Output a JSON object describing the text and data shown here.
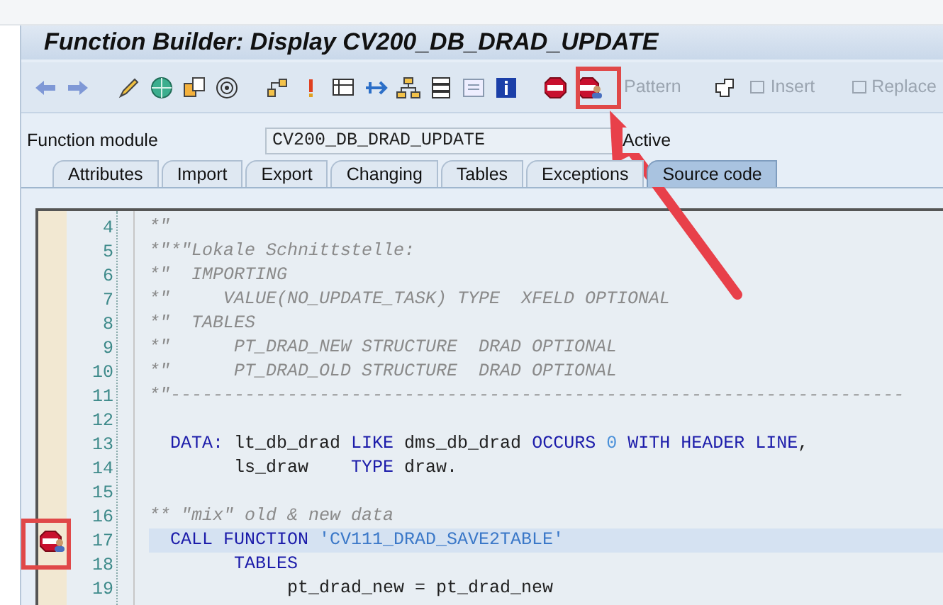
{
  "window": {
    "title": "Function Builder: Display CV200_DB_DRAD_UPDATE"
  },
  "toolbar_buttons": [
    {
      "label": "Pattern",
      "disabled": true
    },
    {
      "label": "Insert",
      "disabled": true
    },
    {
      "label": "Replace",
      "disabled": true
    }
  ],
  "field": {
    "label": "Function module",
    "value": "CV200_DB_DRAD_UPDATE",
    "status": "Active"
  },
  "tabs": [
    {
      "label": "Attributes",
      "selected": false
    },
    {
      "label": "Import",
      "selected": false
    },
    {
      "label": "Export",
      "selected": false
    },
    {
      "label": "Changing",
      "selected": false
    },
    {
      "label": "Tables",
      "selected": false
    },
    {
      "label": "Exceptions",
      "selected": false
    },
    {
      "label": "Source code",
      "selected": true
    }
  ],
  "code_lines": [
    {
      "number": "4",
      "selected": false,
      "breakpoint": false,
      "segments": [
        {
          "kind": "comment",
          "text": "*\""
        }
      ]
    },
    {
      "number": "5",
      "selected": false,
      "breakpoint": false,
      "segments": [
        {
          "kind": "comment",
          "text": "*\"*\"Lokale Schnittstelle:"
        }
      ]
    },
    {
      "number": "6",
      "selected": false,
      "breakpoint": false,
      "segments": [
        {
          "kind": "comment",
          "text": "*\"  IMPORTING"
        }
      ]
    },
    {
      "number": "7",
      "selected": false,
      "breakpoint": false,
      "segments": [
        {
          "kind": "comment",
          "text": "*\"     VALUE(NO_UPDATE_TASK) TYPE  XFELD OPTIONAL"
        }
      ]
    },
    {
      "number": "8",
      "selected": false,
      "breakpoint": false,
      "segments": [
        {
          "kind": "comment",
          "text": "*\"  TABLES"
        }
      ]
    },
    {
      "number": "9",
      "selected": false,
      "breakpoint": false,
      "segments": [
        {
          "kind": "comment",
          "text": "*\"      PT_DRAD_NEW STRUCTURE  DRAD OPTIONAL"
        }
      ]
    },
    {
      "number": "10",
      "selected": false,
      "breakpoint": false,
      "segments": [
        {
          "kind": "comment",
          "text": "*\"      PT_DRAD_OLD STRUCTURE  DRAD OPTIONAL"
        }
      ]
    },
    {
      "number": "11",
      "selected": false,
      "breakpoint": false,
      "segments": [
        {
          "kind": "comment",
          "text": "*\"---------------------------------------------------------------------"
        }
      ]
    },
    {
      "number": "12",
      "selected": false,
      "breakpoint": false
    },
    {
      "number": "13",
      "selected": false,
      "breakpoint": false,
      "segments": [
        {
          "kind": "keyword",
          "text": "  DATA:"
        },
        {
          "kind": "text",
          "text": " lt_db_drad "
        },
        {
          "kind": "keyword",
          "text": "LIKE"
        },
        {
          "kind": "text",
          "text": " dms_db_drad "
        },
        {
          "kind": "keyword",
          "text": "OCCURS"
        },
        {
          "kind": "number",
          "text": " 0 "
        },
        {
          "kind": "keyword",
          "text": "WITH HEADER LINE"
        },
        {
          "kind": "text",
          "text": ","
        }
      ]
    },
    {
      "number": "14",
      "selected": false,
      "breakpoint": false,
      "segments": [
        {
          "kind": "text",
          "text": "        ls_draw    "
        },
        {
          "kind": "keyword",
          "text": "TYPE"
        },
        {
          "kind": "text",
          "text": " draw."
        }
      ]
    },
    {
      "number": "15",
      "selected": false,
      "breakpoint": false
    },
    {
      "number": "16",
      "selected": false,
      "breakpoint": false,
      "segments": [
        {
          "kind": "comment",
          "text": "** \"mix\" old & new data"
        }
      ]
    },
    {
      "number": "17",
      "selected": true,
      "breakpoint": true,
      "segments": [
        {
          "kind": "keyword",
          "text": "  CALL FUNCTION "
        },
        {
          "kind": "string",
          "text": "'CV111_DRAD_SAVE2TABLE'"
        }
      ]
    },
    {
      "number": "18",
      "selected": false,
      "breakpoint": false,
      "segments": [
        {
          "kind": "keyword",
          "text": "        TABLES"
        }
      ]
    },
    {
      "number": "19",
      "selected": false,
      "breakpoint": false,
      "segments": [
        {
          "kind": "text",
          "text": "             pt_drad_new = pt_drad_new"
        }
      ]
    }
  ]
}
